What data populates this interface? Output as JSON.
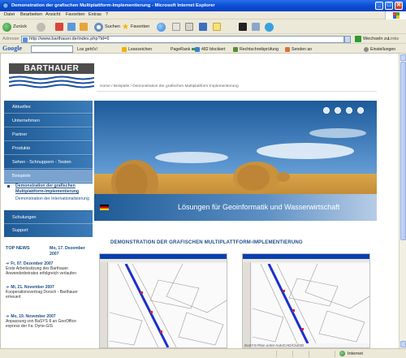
{
  "window": {
    "title": "Demonstration der grafischen Multiplattform-Implementierung - Microsoft Internet Explorer",
    "controls": {
      "minimize": "_",
      "maximize": "□",
      "close": "✕"
    }
  },
  "menu": [
    "Datei",
    "Bearbeiten",
    "Ansicht",
    "Favoriten",
    "Extras",
    "?"
  ],
  "toolbar": {
    "back": "Zurück",
    "search": "Suchen",
    "favorites": "Favoriten"
  },
  "address": {
    "label": "Adresse",
    "url": "http://www.barthauer.de/index.php?id=6",
    "go": "Wechseln zu",
    "links": "Links"
  },
  "googlebar": {
    "logo": "Google",
    "search_label": "Los geht's!",
    "bookmarks": "Lesezeichen",
    "pagerank": "PageRank",
    "blocked": "482 blockiert",
    "spellcheck": "Rechtschreibprüfung",
    "send": "Senden an",
    "settings": "Einstellungen"
  },
  "site": {
    "logo_text": "BARTHAUER",
    "breadcrumb": "Home  /  Beispiele  /  Demonstration der grafischen Multiplattform-Implementierung",
    "nav": [
      "Aktuelles",
      "Unternehmen",
      "Partner",
      "Produkte",
      "Sehen - Schnuppern - Testen",
      "Beispiele"
    ],
    "subnav": [
      "Demonstration der grafischen Multiplattform-Implementierung",
      "Demonstration der Internationalisierung"
    ],
    "nav_bottom": [
      "Schulungen",
      "Support"
    ],
    "banner_caption": "Lösungen für Geoinformatik und Wasserwirtschaft",
    "topnews": {
      "label": "TOP NEWS",
      "date": "Mo, 17. Dezember 2007",
      "items": [
        {
          "date": "Fr, 07. Dezember 2007",
          "text": "Erste Arbeitssitzung des Barthauer Anwenderbeirates erfolgreich verlaufen"
        },
        {
          "date": "Mi, 21. November 2007",
          "text": "Kooperationsvertrag Dorsch - Barthauer erneuert"
        },
        {
          "date": "Mo, 19. November 2007",
          "text": "Anpassung von BaSYS 8 an GeoOffice express der Fa. Dyne-GIS"
        }
      ]
    },
    "demo_title": "DEMONSTRATION DER GRAFISCHEN MULTIPLATTFORM-IMPLEMENTIERUNG",
    "shot_caption_right": "BaSYS-Plan unter AutoCAD/Civil3D"
  },
  "status": {
    "zone": "Internet"
  },
  "colors": {
    "nav": "#1c5590",
    "accent": "#1c4f88",
    "titlebar": "#0a4fd6"
  }
}
